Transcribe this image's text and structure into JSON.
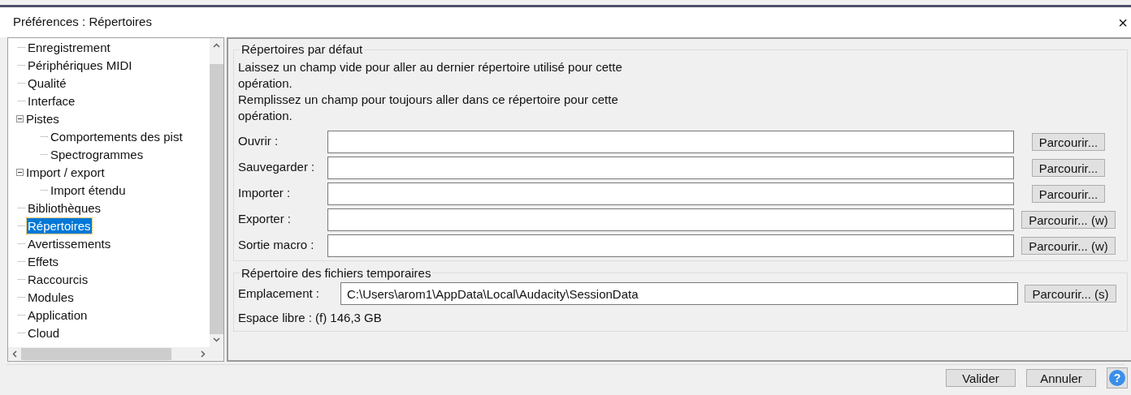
{
  "window": {
    "title": "Préférences : Répertoires",
    "close": "×"
  },
  "tree": [
    {
      "label": "Enregistrement",
      "selected": false
    },
    {
      "label": "Périphériques MIDI",
      "selected": false
    },
    {
      "label": "Qualité",
      "selected": false
    },
    {
      "label": "Interface",
      "selected": false
    },
    {
      "label": "Pistes",
      "selected": false,
      "expanded": true,
      "children": [
        {
          "label": "Comportements des pist",
          "selected": false
        },
        {
          "label": "Spectrogrammes",
          "selected": false
        }
      ]
    },
    {
      "label": "Import / export",
      "selected": false,
      "expanded": true,
      "children": [
        {
          "label": "Import étendu",
          "selected": false
        }
      ]
    },
    {
      "label": "Bibliothèques",
      "selected": false
    },
    {
      "label": "Répertoires",
      "selected": true
    },
    {
      "label": "Avertissements",
      "selected": false
    },
    {
      "label": "Effets",
      "selected": false
    },
    {
      "label": "Raccourcis",
      "selected": false
    },
    {
      "label": "Modules",
      "selected": false
    },
    {
      "label": "Application",
      "selected": false
    },
    {
      "label": "Cloud",
      "selected": false
    }
  ],
  "default_dirs": {
    "title": "Répertoires par défaut",
    "description": [
      "Laissez un champ vide pour aller au dernier répertoire utilisé pour cette opération.",
      "Remplissez un champ pour toujours aller dans ce répertoire pour cette opération."
    ],
    "rows": [
      {
        "label": "Ouvrir :",
        "button": "Parcourir..."
      },
      {
        "label": "Sauvegarder :",
        "button": "Parcourir..."
      },
      {
        "label": "Importer :",
        "button": "Parcourir..."
      },
      {
        "label": "Exporter :",
        "button": "Parcourir... (w)"
      },
      {
        "label": "Sortie macro :",
        "button": "Parcourir... (w)"
      }
    ]
  },
  "temp_dir": {
    "title": "Répertoire des fichiers temporaires",
    "label": "Emplacement :",
    "value": "C:\\Users\\arom1\\AppData\\Local\\Audacity\\SessionData",
    "button": "Parcourir... (s)",
    "free_space": "Espace libre : (f) 146,3 GB"
  },
  "buttons": [
    {
      "label": "Valider"
    },
    {
      "label": "Annuler"
    },
    {
      "label": "?",
      "kind": "help"
    }
  ]
}
